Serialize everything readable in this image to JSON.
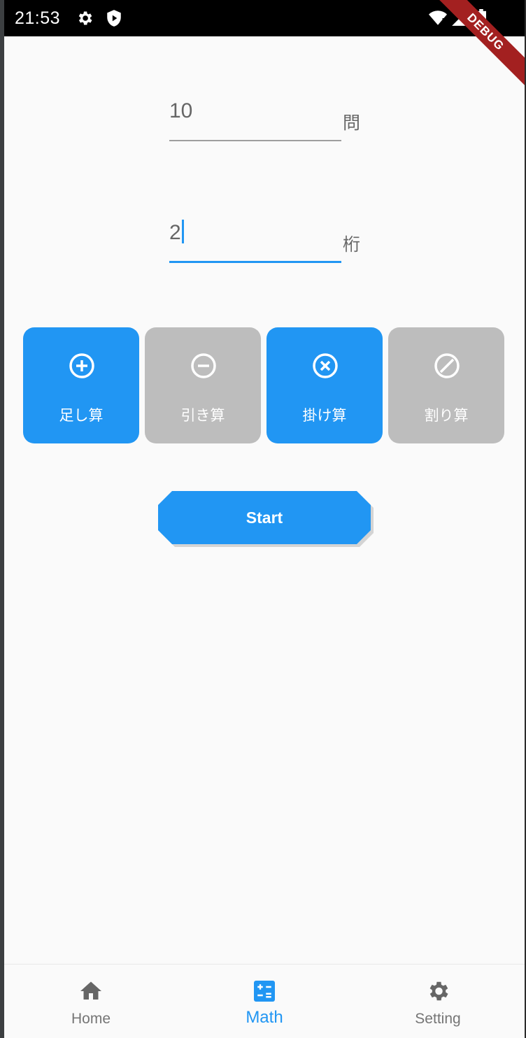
{
  "status_bar": {
    "time": "21:53",
    "icons": [
      "gear-icon",
      "shield-icon",
      "wifi-icon",
      "signal-icon",
      "battery-icon"
    ]
  },
  "debug_banner": "DEBUG",
  "questions_field": {
    "value": "10",
    "suffix": "問"
  },
  "digits_field": {
    "value": "2",
    "suffix": "桁"
  },
  "operations": [
    {
      "label": "足し算",
      "icon": "plus-circle-icon",
      "selected": true
    },
    {
      "label": "引き算",
      "icon": "minus-circle-icon",
      "selected": false
    },
    {
      "label": "掛け算",
      "icon": "times-circle-icon",
      "selected": true
    },
    {
      "label": "割り算",
      "icon": "slash-circle-icon",
      "selected": false
    }
  ],
  "start_button": {
    "label": "Start"
  },
  "bottom_nav": {
    "items": [
      {
        "label": "Home",
        "icon": "home-icon"
      },
      {
        "label": "Math",
        "icon": "calculator-icon",
        "active": true
      },
      {
        "label": "Setting",
        "icon": "gear-icon"
      }
    ]
  },
  "colors": {
    "accent": "#2196f3",
    "inactive_tile": "#bdbdbd",
    "text_grey": "#666666"
  }
}
